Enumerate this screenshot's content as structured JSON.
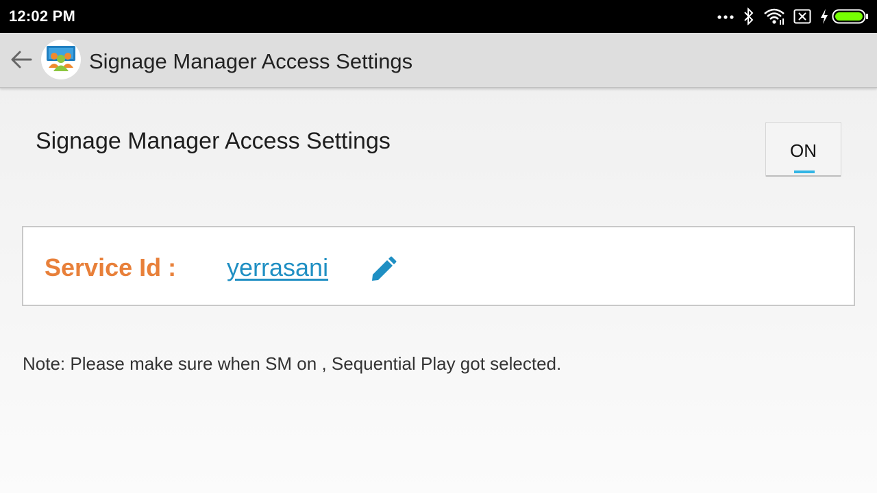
{
  "status_bar": {
    "time": "12:02 PM",
    "icons": [
      "more-dots-icon",
      "bluetooth-icon",
      "wifi-icon",
      "no-sim-icon",
      "charging-icon",
      "battery-icon"
    ],
    "battery_color": "#76ff03"
  },
  "app_bar": {
    "title": "Signage Manager Access Settings",
    "back_icon": "back-arrow-icon",
    "logo_icon": "signage-manager-logo-icon"
  },
  "setting": {
    "label": "Signage Manager Access Settings",
    "toggle_label": "ON",
    "toggle_state": true,
    "indicator_color": "#33b5e5"
  },
  "service": {
    "label": "Service Id :",
    "value": "yerrasani",
    "edit_icon": "pencil-edit-icon",
    "label_color": "#e8803a",
    "value_color": "#1f8fc3"
  },
  "note": {
    "text": "Note: Please make sure when SM on , Sequential Play got selected."
  }
}
